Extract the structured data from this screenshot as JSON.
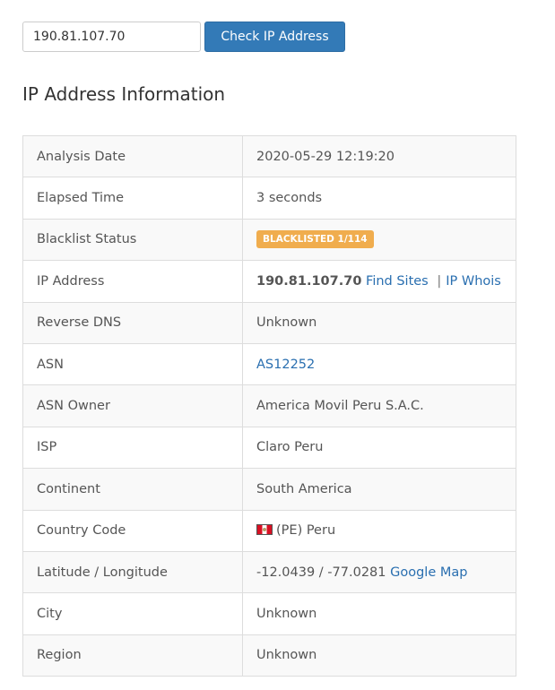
{
  "search": {
    "input_value": "190.81.107.70",
    "button_label": "Check IP Address"
  },
  "section_title": "IP Address Information",
  "info": {
    "analysis_date": {
      "label": "Analysis Date",
      "value": "2020-05-29 12:19:20"
    },
    "elapsed_time": {
      "label": "Elapsed Time",
      "value": "3 seconds"
    },
    "blacklist_status": {
      "label": "Blacklist Status",
      "badge": "BLACKLISTED 1/114",
      "badge_color": "#f0ad4e"
    },
    "ip_address": {
      "label": "IP Address",
      "value": "190.81.107.70",
      "find_sites": "Find Sites",
      "separator": "|",
      "ip_whois": "IP Whois"
    },
    "reverse_dns": {
      "label": "Reverse DNS",
      "value": "Unknown"
    },
    "asn": {
      "label": "ASN",
      "value": "AS12252"
    },
    "asn_owner": {
      "label": "ASN Owner",
      "value": "America Movil Peru S.A.C."
    },
    "isp": {
      "label": "ISP",
      "value": "Claro Peru"
    },
    "continent": {
      "label": "Continent",
      "value": "South America"
    },
    "country_code": {
      "label": "Country Code",
      "value": "(PE) Peru",
      "flag_icon": "peru-flag-icon"
    },
    "lat_long": {
      "label": "Latitude / Longitude",
      "value": "-12.0439 / -77.0281",
      "map_link": "Google Map"
    },
    "city": {
      "label": "City",
      "value": "Unknown"
    },
    "region": {
      "label": "Region",
      "value": "Unknown"
    }
  },
  "colors": {
    "primary_button": "#337ab7",
    "link": "#2a6fb0",
    "warning_badge": "#f0ad4e",
    "stripe": "#f9f9f9",
    "border": "#dddddd"
  }
}
